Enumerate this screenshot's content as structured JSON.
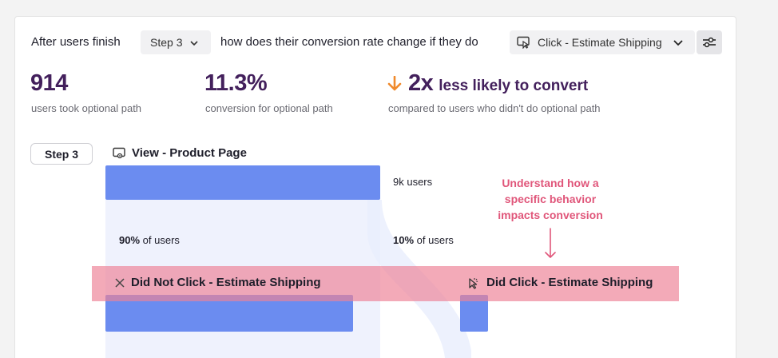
{
  "query": {
    "prefix": "After users finish",
    "step_select": "Step 3",
    "middle": "how does their conversion rate change if they do",
    "event_select": "Click - Estimate Shipping"
  },
  "metrics": [
    {
      "value": "914",
      "caption": "users took optional path"
    },
    {
      "value": "11.3%",
      "caption": "conversion for optional path"
    }
  ],
  "comparison": {
    "value": "2x",
    "tail": "less likely to convert",
    "caption": "compared to users who didn't do optional path",
    "arrow_color": "#f08a2c"
  },
  "funnel": {
    "step_label": "Step 3",
    "step_event": "View - Product Page",
    "step_users": "9k users",
    "not_did": {
      "pct": "90%",
      "pct_suffix": "of users",
      "label_pre": "Did ",
      "label_bold": "Not",
      "label_post": " Click - Estimate Shipping"
    },
    "did": {
      "pct": "10%",
      "pct_suffix": "of users",
      "label": "Did Click - Estimate Shipping"
    }
  },
  "callout": {
    "lines": [
      "Understand how a",
      "specific behavior",
      "impacts conversion"
    ],
    "color": "#e0567a"
  },
  "colors": {
    "bar": "#6b8cf0",
    "accent_text": "#43205c",
    "highlight": "#ee8296"
  }
}
